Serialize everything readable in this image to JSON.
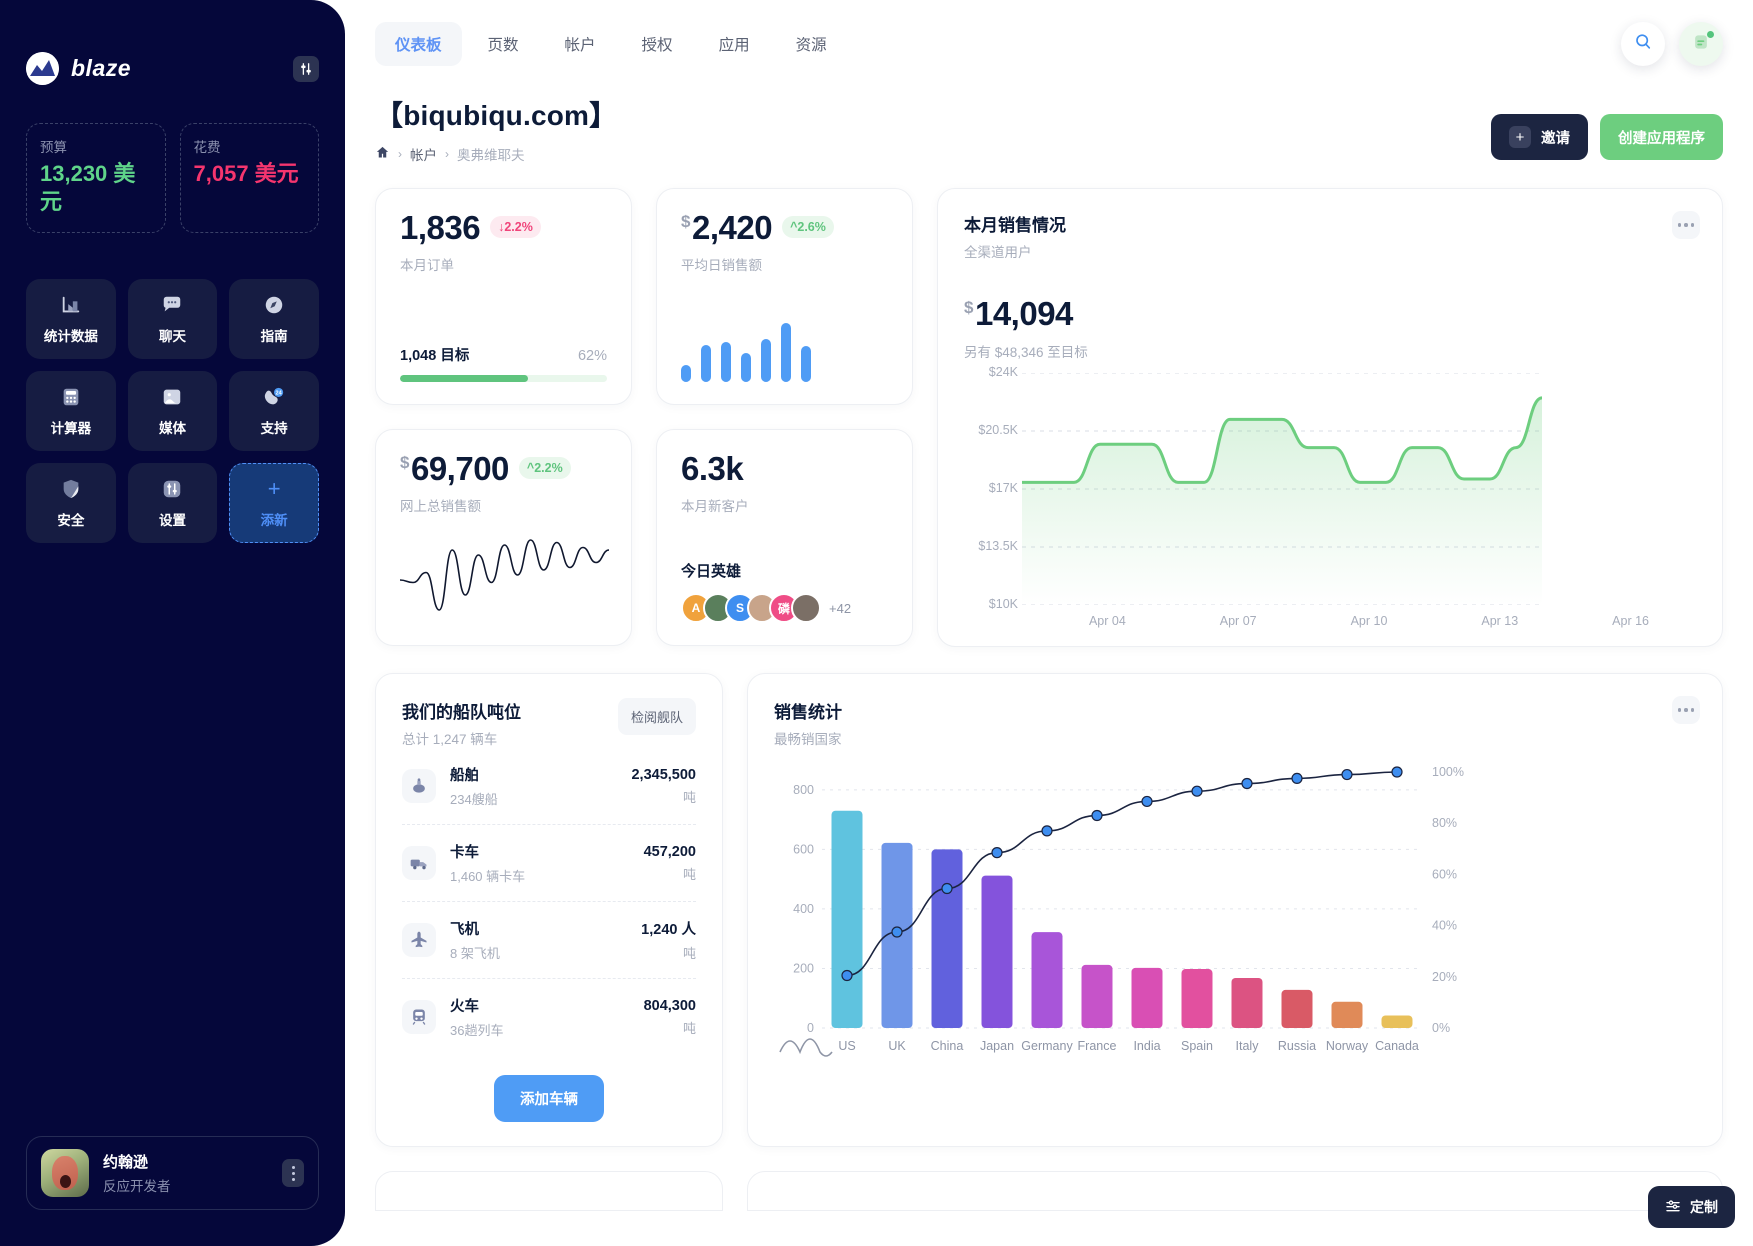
{
  "sidebar": {
    "brand": "blaze",
    "settings_icon": "sliders-icon",
    "totals": [
      {
        "label": "预算",
        "value": "13,230 美元",
        "tone": "green"
      },
      {
        "label": "花费",
        "value": "7,057 美元",
        "tone": "pink"
      }
    ],
    "tiles": [
      {
        "label": "统计数据",
        "icon": "bar-chart-icon"
      },
      {
        "label": "聊天",
        "icon": "chat-bubble-icon"
      },
      {
        "label": "指南",
        "icon": "compass-icon"
      },
      {
        "label": "计算器",
        "icon": "calculator-icon"
      },
      {
        "label": "媒体",
        "icon": "image-icon"
      },
      {
        "label": "支持",
        "icon": "support-24-icon"
      },
      {
        "label": "安全",
        "icon": "shield-icon"
      },
      {
        "label": "设置",
        "icon": "sliders-icon"
      },
      {
        "label": "添新",
        "icon": "plus-icon"
      }
    ],
    "profile": {
      "name": "约翰逊",
      "role": "反应开发者",
      "menu_icon": "vertical-dots-icon"
    }
  },
  "topbar": {
    "tabs": [
      {
        "label": "仪表板",
        "active": true
      },
      {
        "label": "页数",
        "active": false
      },
      {
        "label": "帐户",
        "active": false
      },
      {
        "label": "授权",
        "active": false
      },
      {
        "label": "应用",
        "active": false
      },
      {
        "label": "资源",
        "active": false
      }
    ],
    "search_icon": "search-icon",
    "notes_icon": "note-icon"
  },
  "header": {
    "title": "【biqubiqu.com】",
    "breadcrumb": {
      "home_icon": "home-icon",
      "items": [
        "帐户",
        "奥弗维耶夫"
      ]
    },
    "invite_label": "邀请",
    "create_label": "创建应用程序"
  },
  "cards": {
    "orders": {
      "value": "1,836",
      "delta": "2.2%",
      "delta_dir": "down",
      "label": "本月订单",
      "goal_label": "1,048 目标",
      "goal_pct": "62%",
      "goal_pct_num": 62
    },
    "avg_sales": {
      "currency": "$",
      "value": "2,420",
      "delta": "2.6%",
      "delta_dir": "up",
      "label": "平均日销售额"
    },
    "total_sales": {
      "currency": "$",
      "value": "69,700",
      "delta": "2.2%",
      "delta_dir": "up",
      "label": "网上总销售额"
    },
    "new_customers": {
      "value": "6.3k",
      "label": "本月新客户",
      "heroes_title": "今日英雄",
      "heroes": [
        {
          "initial": "A",
          "color": "#f0a23c"
        },
        {
          "initial": "",
          "color": "#5a7f5c"
        },
        {
          "initial": "S",
          "color": "#3e8ef0"
        },
        {
          "initial": "",
          "color": "#c8a48a"
        },
        {
          "initial": "磷",
          "color": "#ef4d86"
        },
        {
          "initial": "",
          "color": "#7b6f66"
        }
      ],
      "more": "+42"
    },
    "monthly_sales": {
      "title": "本月销售情况",
      "subtitle": "全渠道用户",
      "currency": "$",
      "value": "14,094",
      "note": "另有 $48,346 至目标",
      "menu_icon": "ellipsis-icon"
    }
  },
  "fleet": {
    "title": "我们的船队吨位",
    "subtitle": "总计 1,247 辆车",
    "inspect_label": "检阅舰队",
    "rows": [
      {
        "icon": "ship-icon",
        "name": "船舶",
        "meta": "234艘船",
        "value": "2,345,500",
        "unit": "吨"
      },
      {
        "icon": "truck-icon",
        "name": "卡车",
        "meta": "1,460 辆卡车",
        "value": "457,200",
        "unit": "吨"
      },
      {
        "icon": "plane-icon",
        "name": "飞机",
        "meta": "8 架飞机",
        "value": "1,240 人",
        "unit": "吨"
      },
      {
        "icon": "train-icon",
        "name": "火车",
        "meta": "36趟列车",
        "value": "804,300",
        "unit": "吨"
      }
    ],
    "add_label": "添加车辆"
  },
  "pareto": {
    "title": "销售统计",
    "subtitle": "最畅销国家",
    "menu_icon": "ellipsis-icon",
    "wave_icon": "wave-icon"
  },
  "customize": {
    "label": "定制",
    "icon": "tune-icon"
  },
  "chart_data": [
    {
      "type": "bar",
      "name": "daily-sales-minibars",
      "categories": [
        "1",
        "2",
        "3",
        "4",
        "5",
        "6",
        "7"
      ],
      "values": [
        22,
        48,
        52,
        38,
        55,
        76,
        46
      ],
      "ylim": [
        0,
        80
      ],
      "title": "",
      "xlabel": "",
      "ylabel": "",
      "grid": false,
      "color": "#4f9cf5"
    },
    {
      "type": "line",
      "name": "total-sales-sparkline",
      "x": [
        0,
        1,
        2,
        3,
        4,
        5,
        6,
        7,
        8,
        9,
        10,
        11,
        12,
        13,
        14,
        15,
        16
      ],
      "values": [
        42,
        40,
        48,
        18,
        66,
        30,
        62,
        40,
        70,
        46,
        74,
        50,
        72,
        52,
        68,
        56,
        66
      ],
      "title": "",
      "xlabel": "",
      "ylabel": "",
      "grid": false,
      "color": "#10182f"
    },
    {
      "type": "area",
      "name": "monthly-sales-line",
      "title": "本月销售情况",
      "xlabel": "",
      "ylabel": "",
      "x": [
        "Apr 04",
        "Apr 07",
        "Apr 10",
        "Apr 13",
        "Apr 16"
      ],
      "tick_labels_y": [
        "$24K",
        "$20.5K",
        "$17K",
        "$13.5K",
        "$10K"
      ],
      "ylim": [
        10000,
        24000
      ],
      "grid": true,
      "legend": "none",
      "color": "#6dce7f",
      "values": [
        17400,
        17400,
        17400,
        19700,
        19700,
        19700,
        17400,
        17400,
        21200,
        21200,
        21200,
        19500,
        19500,
        17400,
        17400,
        19500,
        19500,
        17600,
        17600,
        19500,
        22500
      ]
    },
    {
      "type": "bar",
      "name": "sales-by-country-pareto",
      "title": "销售统计",
      "subtitle": "最畅销国家",
      "xlabel": "",
      "ylabel": "",
      "categories": [
        "US",
        "UK",
        "China",
        "Japan",
        "Germany",
        "France",
        "India",
        "Spain",
        "Italy",
        "Russia",
        "Norway",
        "Canada"
      ],
      "tick_labels_y": [
        "0",
        "200",
        "400",
        "600",
        "800"
      ],
      "tick_labels_y2": [
        "0%",
        "20%",
        "40%",
        "60%",
        "80%",
        "100%"
      ],
      "ylim": [
        0,
        860
      ],
      "y2lim": [
        0,
        100
      ],
      "grid": true,
      "legend": "none",
      "series": [
        {
          "name": "销量",
          "type": "bar",
          "values": [
            730,
            622,
            600,
            512,
            322,
            212,
            202,
            198,
            168,
            128,
            88,
            42
          ],
          "colors": [
            "#5fc3df",
            "#6f96e8",
            "#6161dd",
            "#8453dc",
            "#a855d9",
            "#c653c9",
            "#d94fb4",
            "#e2509f",
            "#dc5382",
            "#d95a66",
            "#e08a58",
            "#e8c05a"
          ]
        },
        {
          "name": "累计百分比",
          "type": "line",
          "values": [
            20.5,
            37.5,
            54.5,
            68.5,
            77.0,
            83.0,
            88.5,
            92.5,
            95.5,
            97.5,
            99.0,
            100.0
          ],
          "color": "#1b2440",
          "marker_color": "#3e8ef0"
        }
      ]
    }
  ]
}
